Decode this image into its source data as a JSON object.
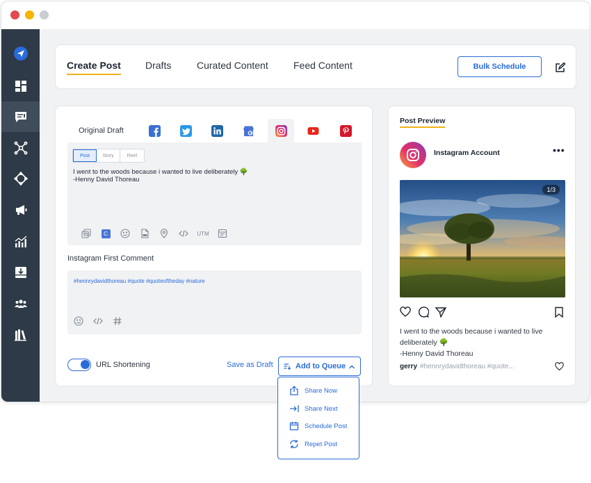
{
  "header": {
    "tabs": [
      {
        "label": "Create Post",
        "active": true
      },
      {
        "label": "Drafts"
      },
      {
        "label": "Curated Content"
      },
      {
        "label": "Feed Content"
      }
    ],
    "bulk_schedule_label": "Bulk Schedule"
  },
  "sidebar": {
    "icons": [
      "send-logo-icon",
      "dashboard-icon",
      "compose-icon",
      "network-icon",
      "move-icon",
      "megaphone-icon",
      "analytics-icon",
      "inbox-icon",
      "users-icon",
      "library-icon"
    ]
  },
  "composer": {
    "original_draft_label": "Original Draft",
    "networks": [
      "facebook",
      "twitter",
      "linkedin",
      "google-business",
      "instagram",
      "youtube",
      "pinterest"
    ],
    "active_network": "instagram",
    "post_types": [
      "Post",
      "Story",
      "Reel"
    ],
    "post_text_line1": "I went to the woods because i wanted to live deliberately 🌳",
    "post_text_line2": "-Henny David Thoreau",
    "tool_utm": "UTM",
    "tool_c": "C",
    "first_comment_label": "Instagram First Comment",
    "first_comment_text": "#hennrydavidthoreau #quote #quoteoftheday #nature",
    "url_shortening_label": "URL Shortening",
    "url_shortening_on": true,
    "save_draft_label": "Save as Draft",
    "add_queue_label": "Add to Queue"
  },
  "dropdown": {
    "items": [
      "Share Now",
      "Share Next",
      "Schedule Post",
      "Repet Post"
    ]
  },
  "preview": {
    "title": "Post Preview",
    "account_name": "Instagram Account",
    "more": "•••",
    "counter": "1/3",
    "caption_line1": "I went to the woods because i wanted to live deliberately 🌳",
    "caption_line2": "-Henny David Thoreau",
    "comment_user": "gerry",
    "comment_text": "#hennrydavidthoreau #quote..."
  },
  "colors": {
    "accent": "#2a6bd8",
    "sidebar": "#2e3a47",
    "underline": "#f0b21a"
  }
}
